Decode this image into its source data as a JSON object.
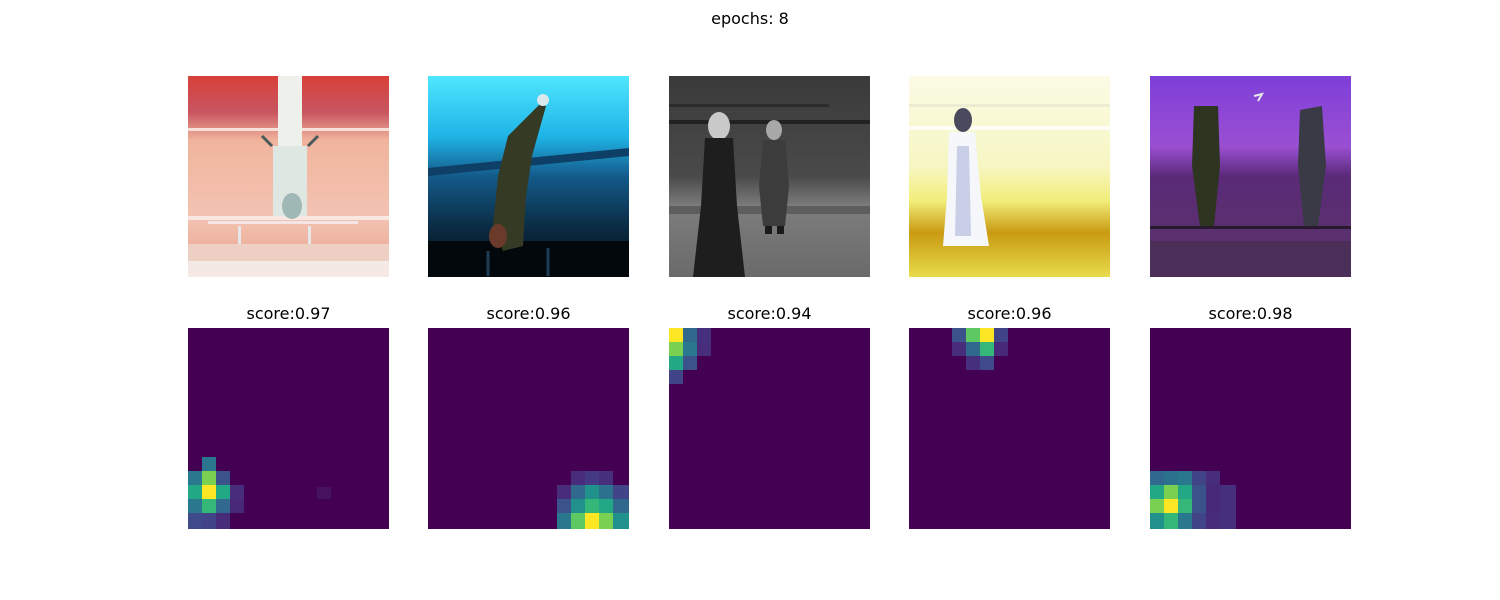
{
  "figure": {
    "title": "epochs: 8"
  },
  "photos": [
    {
      "name": "inverted-figure-red"
    },
    {
      "name": "inverted-figure-cyan"
    },
    {
      "name": "two-people-grayscale"
    },
    {
      "name": "figure-inferno"
    },
    {
      "name": "two-figures-purple"
    }
  ],
  "heatmaps": [
    {
      "title": "score:0.97"
    },
    {
      "title": "score:0.96"
    },
    {
      "title": "score:0.94"
    },
    {
      "title": "score:0.96"
    },
    {
      "title": "score:0.98"
    }
  ],
  "colors": {
    "viridis_low": "#440154",
    "viridis_high": "#fde725"
  }
}
